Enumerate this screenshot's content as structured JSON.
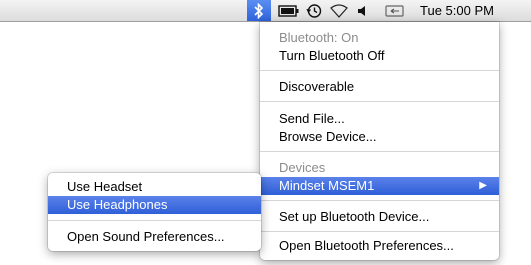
{
  "menubar": {
    "icons": [
      "bluetooth-icon",
      "battery-icon",
      "time-machine-icon",
      "wifi-icon",
      "volume-icon",
      "display-icon"
    ],
    "clock": "Tue 5:00 PM",
    "accent": "#3b6fe6"
  },
  "bluetooth_menu": {
    "status": "Bluetooth: On",
    "turn_off": "Turn Bluetooth Off",
    "discoverable": "Discoverable",
    "send_file": "Send File...",
    "browse_device": "Browse Device...",
    "devices_header": "Devices",
    "device_name": "Mindset MSEM1",
    "setup": "Set up Bluetooth Device...",
    "open_prefs": "Open Bluetooth Preferences..."
  },
  "device_submenu": {
    "use_headset": "Use Headset",
    "use_headphones": "Use Headphones",
    "open_sound_prefs": "Open Sound Preferences..."
  },
  "colors": {
    "highlight": "#3a68dd",
    "disabled_text": "#8c8c8c"
  }
}
